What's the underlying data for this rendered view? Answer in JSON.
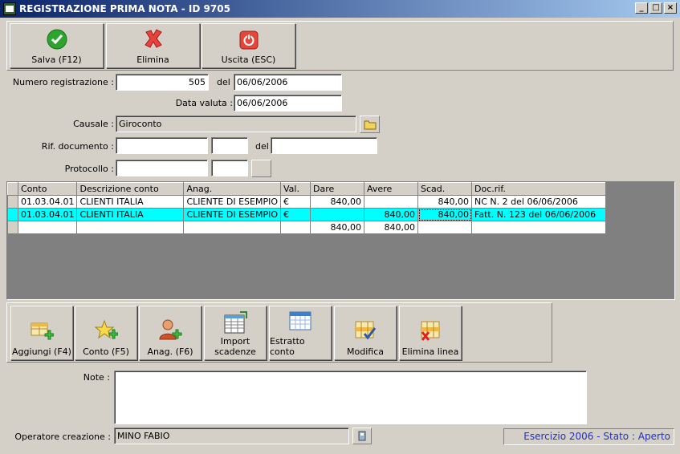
{
  "window": {
    "title": "REGISTRAZIONE PRIMA NOTA - ID 9705",
    "minimize": "_",
    "restore": "□",
    "close": "×"
  },
  "toolbar": {
    "save_label": "Salva (F12)",
    "delete_label": "Elimina",
    "exit_label": "Uscita (ESC)"
  },
  "form": {
    "numero_label": "Numero registrazione :",
    "numero_value": "505",
    "del_label": "del",
    "del_value": "06/06/2006",
    "valuta_label": "Data valuta :",
    "valuta_value": "06/06/2006",
    "causale_label": "Causale :",
    "causale_value": "Giroconto",
    "rif_label": "Rif. documento :",
    "rif_del_label": "del",
    "protocollo_label": "Protocollo :"
  },
  "grid": {
    "headers": [
      "Conto",
      "Descrizione conto",
      "Anag.",
      "Val.",
      "Dare",
      "Avere",
      "Scad.",
      "Doc.rif."
    ],
    "rows": [
      [
        "01.03.04.01",
        "CLIENTI ITALIA",
        "CLIENTE DI ESEMPIO",
        "€",
        "840,00",
        "",
        "840,00",
        "NC N. 2 del 06/06/2006"
      ],
      [
        "01.03.04.01",
        "CLIENTI ITALIA",
        "CLIENTE DI ESEMPIO",
        "€",
        "",
        "840,00",
        "840,00",
        "Fatt. N. 123 del 06/06/2006"
      ]
    ],
    "totals": [
      "",
      "",
      "",
      "",
      "840,00",
      "840,00",
      "",
      ""
    ]
  },
  "actions": {
    "add": "Aggiungi (F4)",
    "conto": "Conto (F5)",
    "anag": "Anag. (F6)",
    "import_line1": "Import",
    "import_line2": "scadenze",
    "estratto": "Estratto conto",
    "modifica": "Modifica",
    "elimina_linea": "Elimina linea"
  },
  "note": {
    "label": "Note :",
    "value": ""
  },
  "operatore": {
    "label": "Operatore creazione :",
    "value": "MINO FABIO"
  },
  "status": {
    "text": "Esercizio 2006 - Stato : Aperto",
    "color": "#1e32c8"
  },
  "colors": {
    "titlebar": "#0a246a",
    "selected_row": "#00ffff",
    "window_bg": "#d4d0c8"
  }
}
